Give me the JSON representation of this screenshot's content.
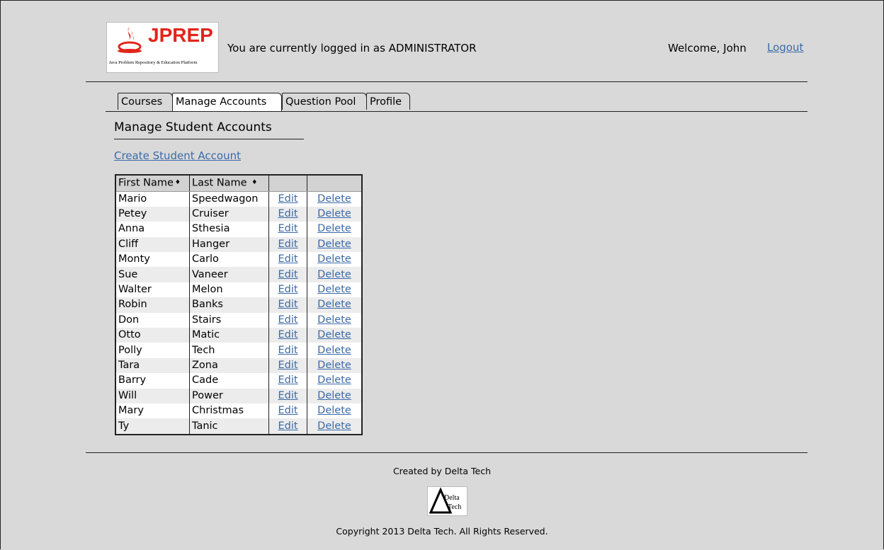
{
  "header": {
    "logo_text": "JPREP",
    "logo_tagline": "Java Problem Repository & Education Platform",
    "logged_in_text": "You are currently logged in as ADMINISTRATOR",
    "welcome_text": "Welcome, John",
    "logout_label": "Logout"
  },
  "tabs": [
    {
      "label": "Courses"
    },
    {
      "label": "Manage Accounts",
      "active": true
    },
    {
      "label": "Question Pool"
    },
    {
      "label": "Profile"
    }
  ],
  "main": {
    "title": "Manage Student Accounts",
    "create_link": "Create Student Account",
    "table": {
      "columns": [
        "First Name",
        "Last Name",
        "",
        ""
      ],
      "edit_label": "Edit",
      "delete_label": "Delete",
      "rows": [
        {
          "first": "Mario",
          "last": "Speedwagon"
        },
        {
          "first": "Petey",
          "last": "Cruiser"
        },
        {
          "first": "Anna",
          "last": "Sthesia"
        },
        {
          "first": "Cliff",
          "last": "Hanger"
        },
        {
          "first": "Monty",
          "last": "Carlo"
        },
        {
          "first": "Sue",
          "last": "Vaneer"
        },
        {
          "first": "Walter",
          "last": "Melon"
        },
        {
          "first": "Robin",
          "last": "Banks"
        },
        {
          "first": "Don",
          "last": "Stairs"
        },
        {
          "first": "Otto",
          "last": "Matic"
        },
        {
          "first": "Polly",
          "last": "Tech"
        },
        {
          "first": "Tara",
          "last": "Zona"
        },
        {
          "first": "Barry",
          "last": "Cade"
        },
        {
          "first": "Will",
          "last": "Power"
        },
        {
          "first": "Mary",
          "last": "Christmas"
        },
        {
          "first": "Ty",
          "last": "Tanic"
        }
      ]
    }
  },
  "footer": {
    "created_by": "Created by Delta Tech",
    "logo_text_1": "Delta",
    "logo_text_2": "Tech",
    "copyright": "Copyright 2013 Delta Tech. All Rights Reserved."
  },
  "colors": {
    "background": "#d9d9d9",
    "link": "#3b6aa8",
    "brand_red": "#e1251b"
  },
  "icons": [
    "jprep-logo-icon",
    "sort-icon",
    "delta-tech-logo-icon"
  ]
}
